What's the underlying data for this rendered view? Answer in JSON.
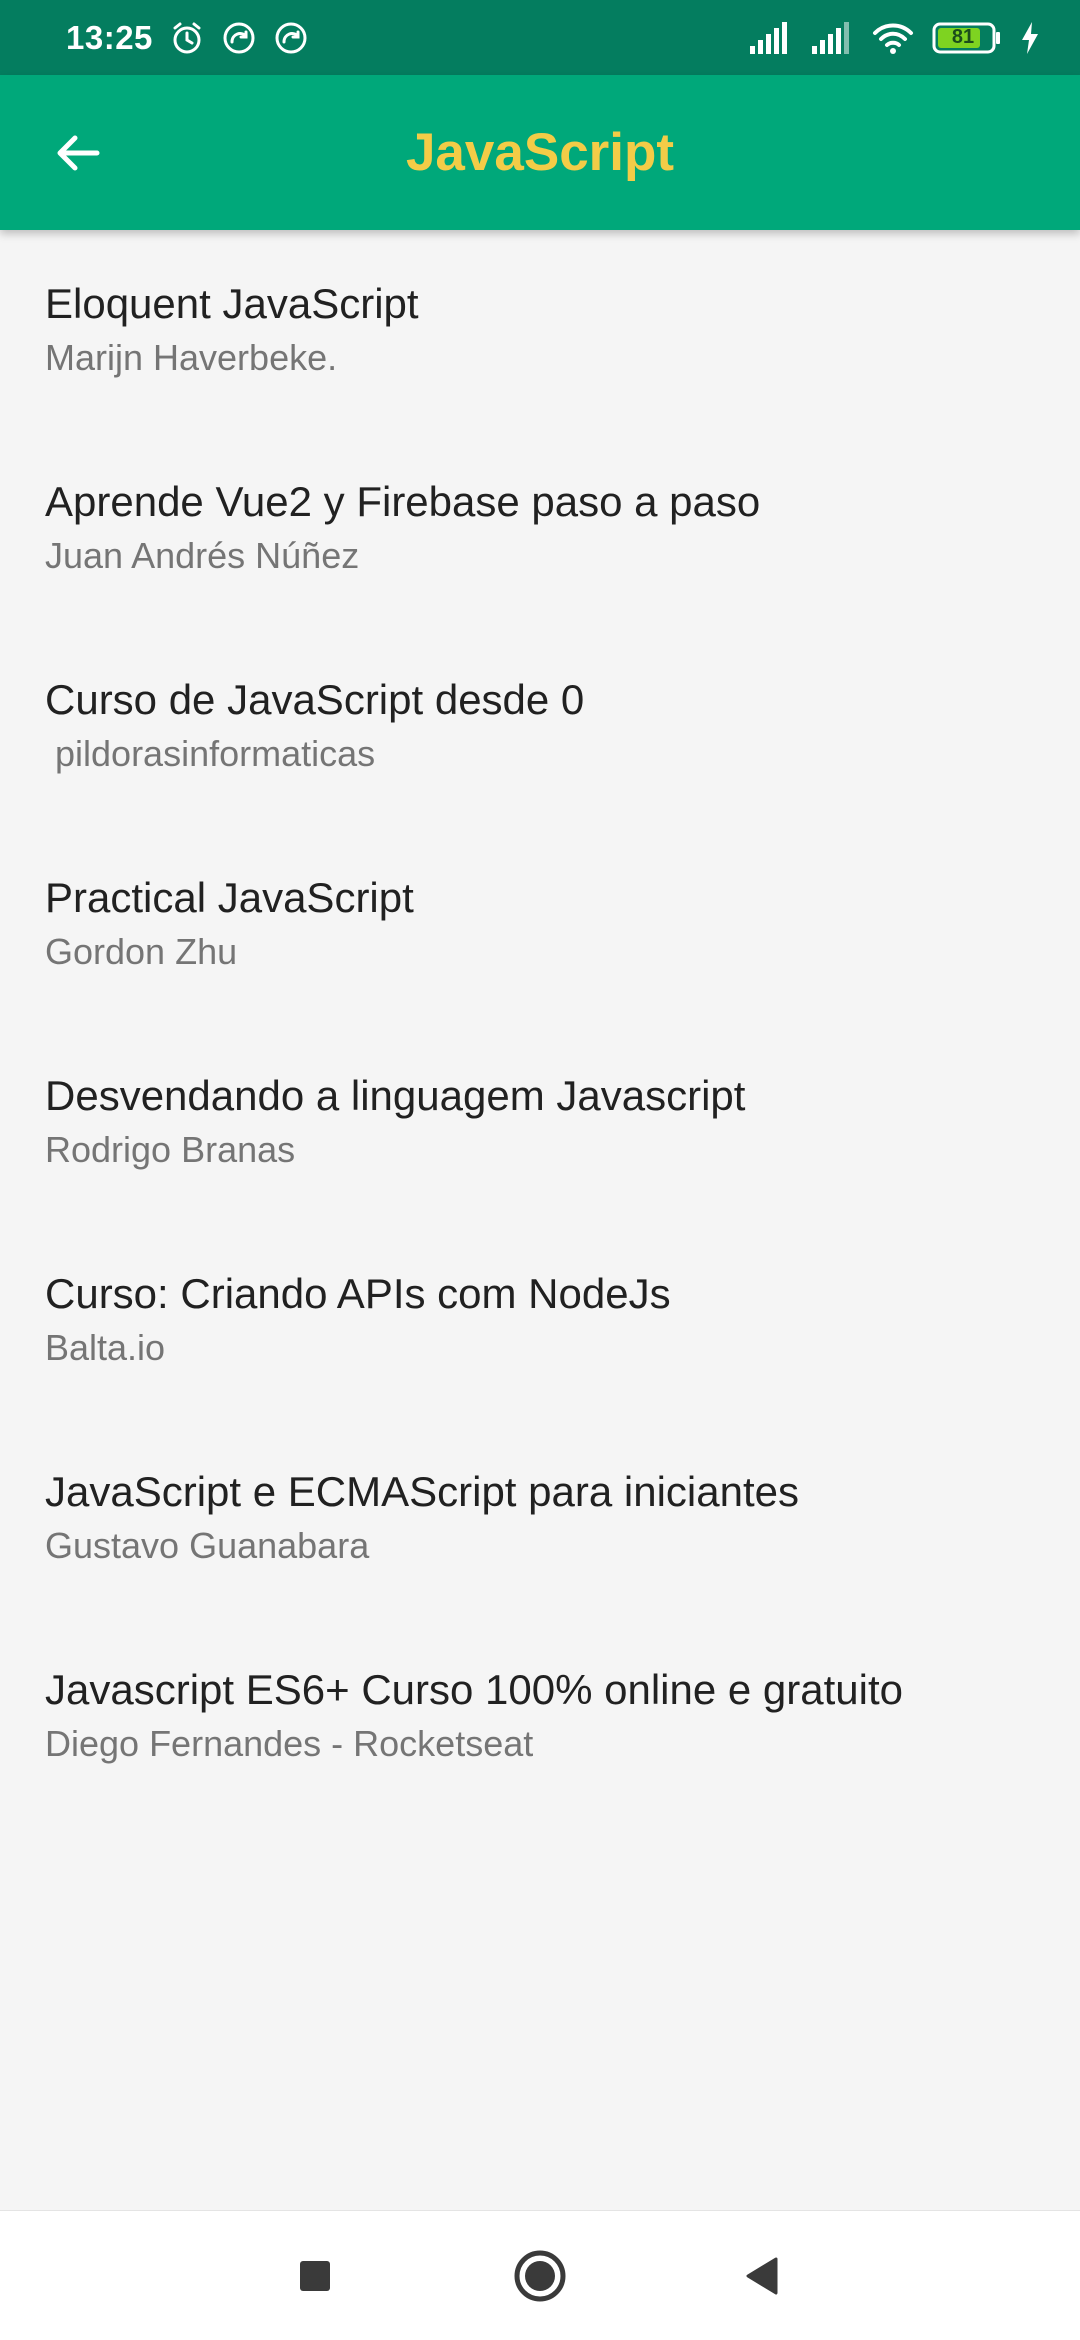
{
  "status_bar": {
    "time": "13:25",
    "battery_level": "81",
    "icons": [
      "alarm-icon",
      "sync-icon",
      "sync-icon",
      "signal-icon",
      "signal-icon",
      "wifi-icon",
      "battery-icon",
      "charging-icon"
    ]
  },
  "app_bar": {
    "title": "JavaScript",
    "back_icon": "arrow-back-icon",
    "title_color": "#f3cc47",
    "background": "#00a87a"
  },
  "courses": [
    {
      "title": "Eloquent JavaScript",
      "author": "Marijn Haverbeke."
    },
    {
      "title": "Aprende Vue2 y Firebase paso a paso",
      "author": "Juan Andrés Núñez"
    },
    {
      "title": "Curso de JavaScript desde 0",
      "author": " pildorasinformaticas"
    },
    {
      "title": "Practical JavaScript",
      "author": "Gordon Zhu"
    },
    {
      "title": "Desvendando a linguagem Javascript",
      "author": "Rodrigo Branas"
    },
    {
      "title": "Curso: Criando APIs com NodeJs",
      "author": "Balta.io"
    },
    {
      "title": "JavaScript e ECMAScript para iniciantes",
      "author": "Gustavo Guanabara"
    },
    {
      "title": "Javascript ES6+ Curso 100% online e gratuito",
      "author": "Diego Fernandes - Rocketseat"
    }
  ],
  "nav_bar": {
    "icons": [
      "recents-square-icon",
      "home-circle-icon",
      "back-triangle-icon"
    ]
  }
}
